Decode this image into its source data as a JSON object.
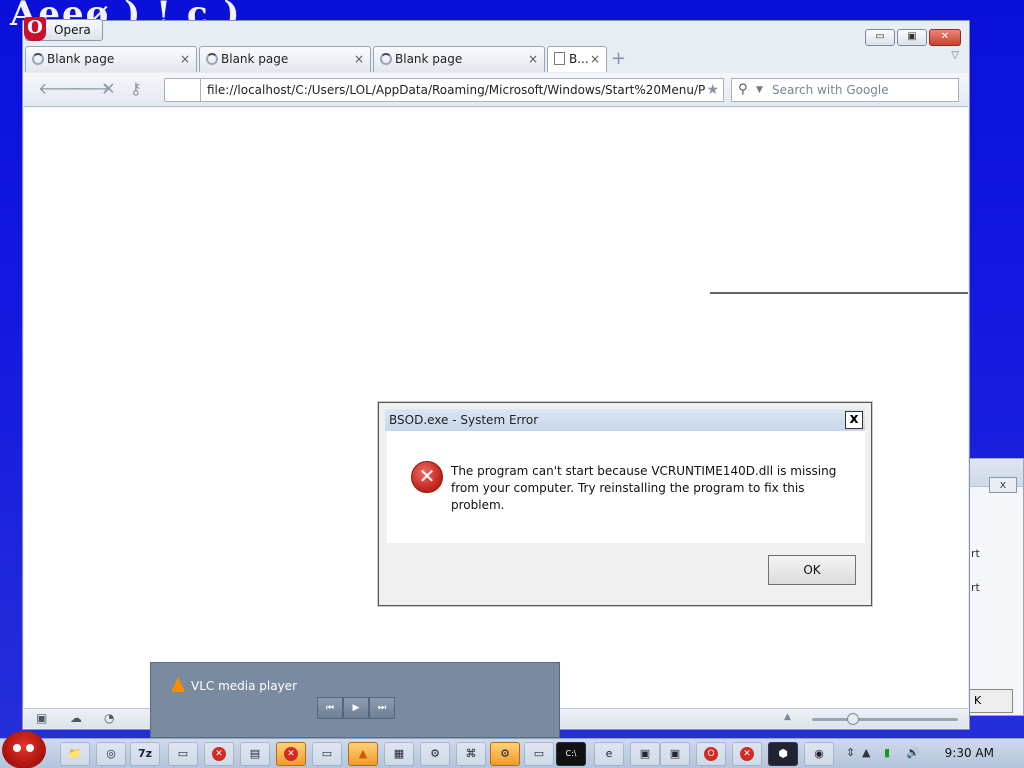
{
  "desktop_text": "Ãeeø ) ! c )",
  "opera": {
    "badge": "Opera",
    "controls": {
      "minimize": "▭",
      "restore": "▣",
      "close": "✕"
    },
    "tabs": [
      {
        "label": "Blank page"
      },
      {
        "label": "Blank page"
      },
      {
        "label": "Blank page"
      },
      {
        "label": "B..."
      }
    ],
    "tab_close": "×",
    "new_tab": "+",
    "address": "file://localhost/C:/Users/LOL/AppData/Roaming/Microsoft/Windows/Start%20Menu/P",
    "search_placeholder": "Search with Google"
  },
  "dialog": {
    "title": "BSOD.exe - System Error",
    "close": "x",
    "message": "The program can't start because VCRUNTIME140D.dll is missing from your computer. Try reinstalling the program to fix this problem.",
    "ok": "OK"
  },
  "back_window": {
    "close": "x",
    "line1": "rt",
    "line2": "rt",
    "button": "K"
  },
  "vlc": {
    "title": "VLC media player",
    "prev": "⏮",
    "play": "▶",
    "next": "⏭"
  },
  "taskbar": {
    "time": "9:30 AM",
    "app_7z": "7z",
    "app_cmd": "C:\\",
    "app_ie": "e"
  }
}
